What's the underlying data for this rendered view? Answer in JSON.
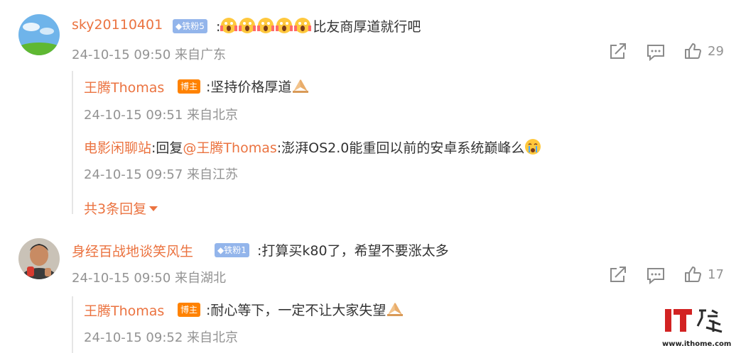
{
  "comments": [
    {
      "user": "sky20110401",
      "badge": "铁粉5",
      "text": "比友商厚道就行吧",
      "time": "24-10-15 09:50",
      "location": "来自广东",
      "likes": "29",
      "replies": [
        {
          "user": "王腾Thomas",
          "badge": "博主",
          "text": ":坚持价格厚道",
          "time": "24-10-15 09:51",
          "location": "来自北京"
        },
        {
          "user": "电影闲聊站",
          "reply_prefix": ":回复",
          "mention": "@王腾Thomas",
          "text": ":澎湃OS2.0能重回以前的安卓系统巅峰么",
          "time": "24-10-15 09:57",
          "location": "来自江苏"
        }
      ],
      "more_replies": "共3条回复"
    },
    {
      "user": "身经百战地谈笑风生",
      "badge": "铁粉1",
      "text": ":打算买k80了，希望不要涨太多",
      "time": "24-10-15 09:50",
      "location": "来自湖北",
      "likes": "17",
      "replies": [
        {
          "user": "王腾Thomas",
          "badge": "博主",
          "text": ":耐心等下，一定不让大家失望",
          "time": "24-10-15 09:52",
          "location": "来自北京"
        }
      ]
    }
  ],
  "colon": ":",
  "watermark": {
    "logo_text": "IT之家",
    "url": "www.ithome.com"
  },
  "colors": {
    "username": "#eb7340",
    "meta": "#939393",
    "fan_badge": "#93b5eb",
    "blogger_badge": "#ff8200"
  }
}
